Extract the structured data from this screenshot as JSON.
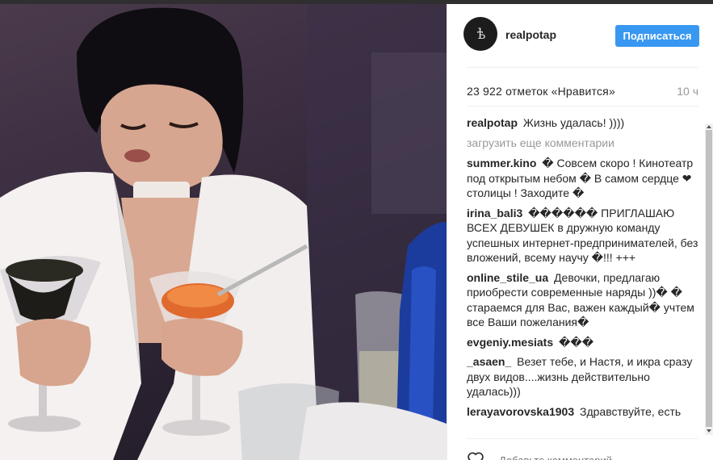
{
  "post": {
    "username": "realpotap",
    "follow_label": "Подписаться",
    "likes": "23 922 отметок «Нравится»",
    "time": "10 ч",
    "load_more": "загрузить еще комментарии",
    "add_comment_placeholder": "Добавьте комментарий...",
    "more_label": "...",
    "avatar_glyph": "ѣ"
  },
  "comments": [
    {
      "user": "realpotap",
      "text": "Жизнь удалась! ))))"
    },
    {
      "user": "summer.kino",
      "text": "� Совсем скоро ! Кинотеатр под открытым небом � В самом сердце ❤ столицы ! Заходите �"
    },
    {
      "user": "irina_bali3",
      "text": "������ ПРИГЛАШАЮ ВСЕХ ДЕВУШЕК в дружную команду успешных интернет-предпринимателей, без вложений, всему научу �!!! +++"
    },
    {
      "user": "online_stile_ua",
      "text": "Девочки, предлагаю приобрести современные наряды ))� � стараемся для Вас, важен каждый� учтем все Ваши пожелания�"
    },
    {
      "user": "evgeniy.mesiats",
      "text": "���"
    },
    {
      "user": "_asaen_",
      "text": "Везет тебе, и Настя, и икра сразу двух видов....жизнь действительно удалась)))"
    },
    {
      "user": "lerayavorovska1903",
      "text": "Здравствуйте, есть"
    }
  ],
  "colors": {
    "accent": "#3897f0",
    "text": "#262626",
    "muted": "#999999"
  },
  "icons": {
    "heart": "heart-icon",
    "avatar": "brand-logo-icon"
  }
}
